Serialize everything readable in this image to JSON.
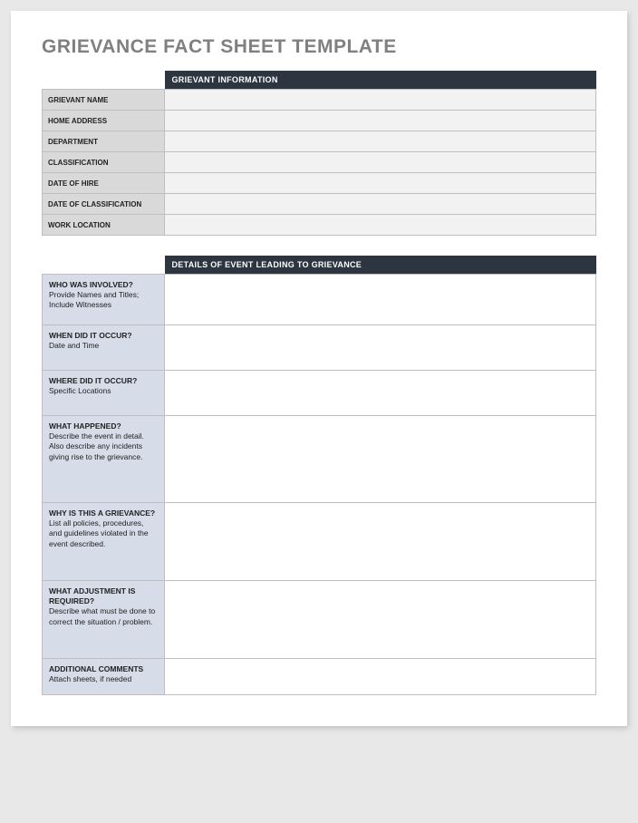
{
  "title": "GRIEVANCE FACT SHEET TEMPLATE",
  "section1_header": "GRIEVANT INFORMATION",
  "section2_header": "DETAILS OF EVENT LEADING TO GRIEVANCE",
  "info": {
    "grievant_name": {
      "label": "GRIEVANT NAME",
      "value": ""
    },
    "home_address": {
      "label": "HOME ADDRESS",
      "value": ""
    },
    "department": {
      "label": "DEPARTMENT",
      "value": ""
    },
    "classification": {
      "label": "CLASSIFICATION",
      "value": ""
    },
    "date_of_hire": {
      "label": "DATE OF HIRE",
      "value": ""
    },
    "date_of_classification": {
      "label": "DATE OF CLASSIFICATION",
      "value": ""
    },
    "work_location": {
      "label": "WORK LOCATION",
      "value": ""
    }
  },
  "details": {
    "who": {
      "q": "WHO WAS INVOLVED?",
      "hint": "Provide Names and Titles; Include Witnesses",
      "value": ""
    },
    "when": {
      "q": "WHEN DID IT OCCUR?",
      "hint": "Date and Time",
      "value": ""
    },
    "where": {
      "q": "WHERE DID IT OCCUR?",
      "hint": "Specific Locations",
      "value": ""
    },
    "what": {
      "q": "WHAT HAPPENED?",
      "hint": "Describe the event in detail. Also describe any incidents giving rise to the grievance.",
      "value": ""
    },
    "why": {
      "q": "WHY IS THIS A GRIEVANCE?",
      "hint": "List all policies, procedures, and guidelines violated in the event described.",
      "value": ""
    },
    "adjust": {
      "q": "WHAT ADJUSTMENT IS REQUIRED?",
      "hint": "Describe what must be done to correct the situation / problem.",
      "value": ""
    },
    "comments": {
      "q": "ADDITIONAL COMMENTS",
      "hint": "Attach sheets, if needed",
      "value": ""
    }
  }
}
